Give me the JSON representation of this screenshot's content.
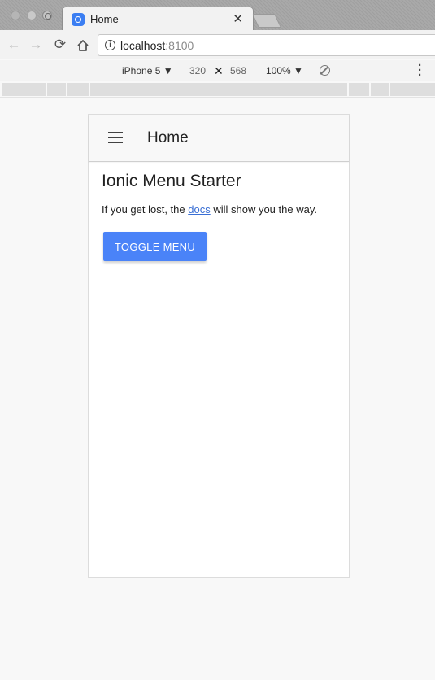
{
  "browser": {
    "tab_title": "Home",
    "tab_close": "✕",
    "url_host": "localhost",
    "url_port": ":8100"
  },
  "device_toolbar": {
    "device": "iPhone 5 ▼",
    "width": "320",
    "times": "✕",
    "height": "568",
    "zoom": "100% ▼"
  },
  "app": {
    "header_title": "Home",
    "heading": "Ionic Menu Starter",
    "text_before": "If you get lost, the ",
    "link_text": "docs",
    "text_after": " will show you the way.",
    "button_label": "TOGGLE MENU",
    "button_color": "#4a83f8"
  }
}
